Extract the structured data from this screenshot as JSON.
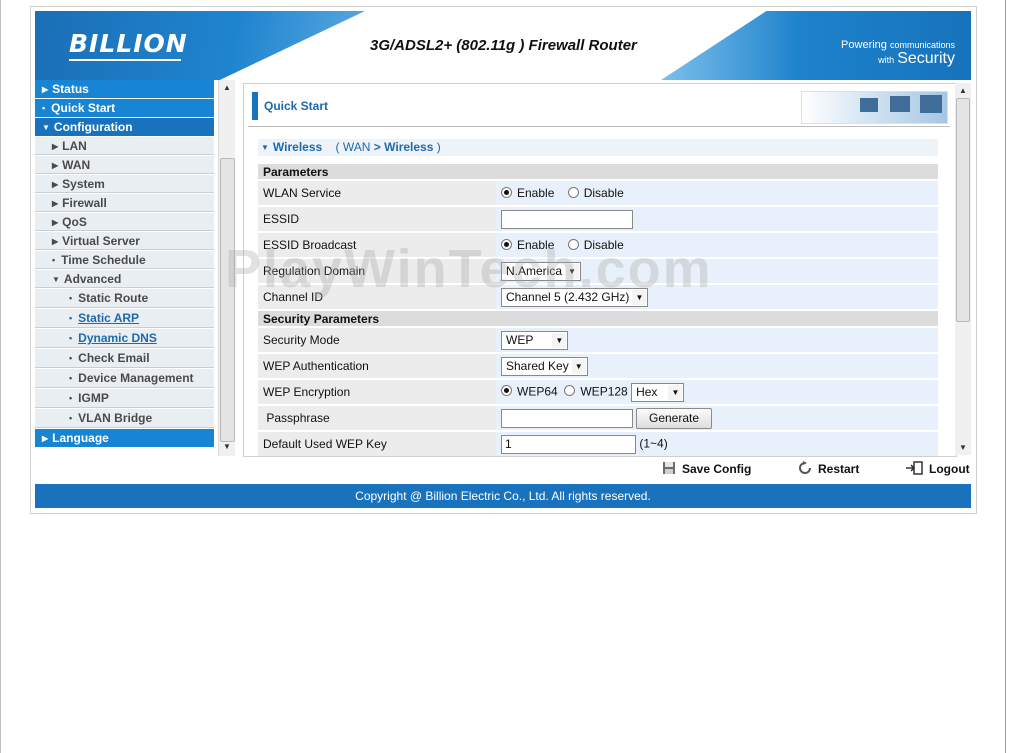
{
  "header": {
    "logo": "BILLION",
    "title": "3G/ADSL2+ (802.11g ) Firewall Router",
    "tagline_small_1": "Powering",
    "tagline_small_2": "communications",
    "tagline_small_3": "with",
    "tagline_big": "Security"
  },
  "sidebar": {
    "items": [
      {
        "label": "Status",
        "level": "top"
      },
      {
        "label": "Quick Start",
        "level": "top"
      },
      {
        "label": "Configuration",
        "level": "top-open"
      },
      {
        "label": "LAN",
        "level": "sub"
      },
      {
        "label": "WAN",
        "level": "sub"
      },
      {
        "label": "System",
        "level": "sub"
      },
      {
        "label": "Firewall",
        "level": "sub"
      },
      {
        "label": "QoS",
        "level": "sub"
      },
      {
        "label": "Virtual Server",
        "level": "sub"
      },
      {
        "label": "Time Schedule",
        "level": "sub"
      },
      {
        "label": "Advanced",
        "level": "sub-open"
      },
      {
        "label": "Static Route",
        "level": "sub2"
      },
      {
        "label": "Static ARP",
        "level": "sub2"
      },
      {
        "label": "Dynamic DNS",
        "level": "sub2"
      },
      {
        "label": "Check Email",
        "level": "sub2"
      },
      {
        "label": "Device Management",
        "level": "sub2"
      },
      {
        "label": "IGMP",
        "level": "sub2"
      },
      {
        "label": "VLAN Bridge",
        "level": "sub2"
      },
      {
        "label": "Language",
        "level": "top"
      }
    ]
  },
  "main": {
    "title": "Quick Start",
    "section": {
      "name": "Wireless",
      "bc_open": "(",
      "bc_1": "WAN",
      "bc_sep": ">",
      "bc_2": "Wireless",
      "bc_close": ")"
    },
    "params_header": "Parameters",
    "wlan_service": {
      "label": "WLAN Service",
      "opt1": "Enable",
      "opt2": "Disable"
    },
    "essid": {
      "label": "ESSID",
      "value": ""
    },
    "essid_broadcast": {
      "label": "ESSID Broadcast",
      "opt1": "Enable",
      "opt2": "Disable"
    },
    "regulation_domain": {
      "label": "Regulation Domain",
      "value": "N.America"
    },
    "channel_id": {
      "label": "Channel ID",
      "value": "Channel 5 (2.432 GHz)"
    },
    "security_header": "Security Parameters",
    "security_mode": {
      "label": "Security Mode",
      "value": "WEP"
    },
    "wep_auth": {
      "label": "WEP Authentication",
      "value": "Shared Key"
    },
    "wep_encryption": {
      "label": "WEP Encryption",
      "opt1": "WEP64",
      "opt2": "WEP128",
      "format": "Hex"
    },
    "passphrase": {
      "label": "Passphrase",
      "button": "Generate"
    },
    "default_key": {
      "label": "Default Used WEP Key",
      "value": "1",
      "hint": "(1~4)"
    }
  },
  "actions": {
    "save": "Save Config",
    "restart": "Restart",
    "logout": "Logout"
  },
  "footer": "Copyright @ Billion Electric Co., Ltd. All rights reserved.",
  "watermark": "PlayWinTech.com",
  "colors": {
    "brand_blue": "#1872bd",
    "nav_blue": "#1784d4",
    "link_blue": "#1c6ab0"
  }
}
